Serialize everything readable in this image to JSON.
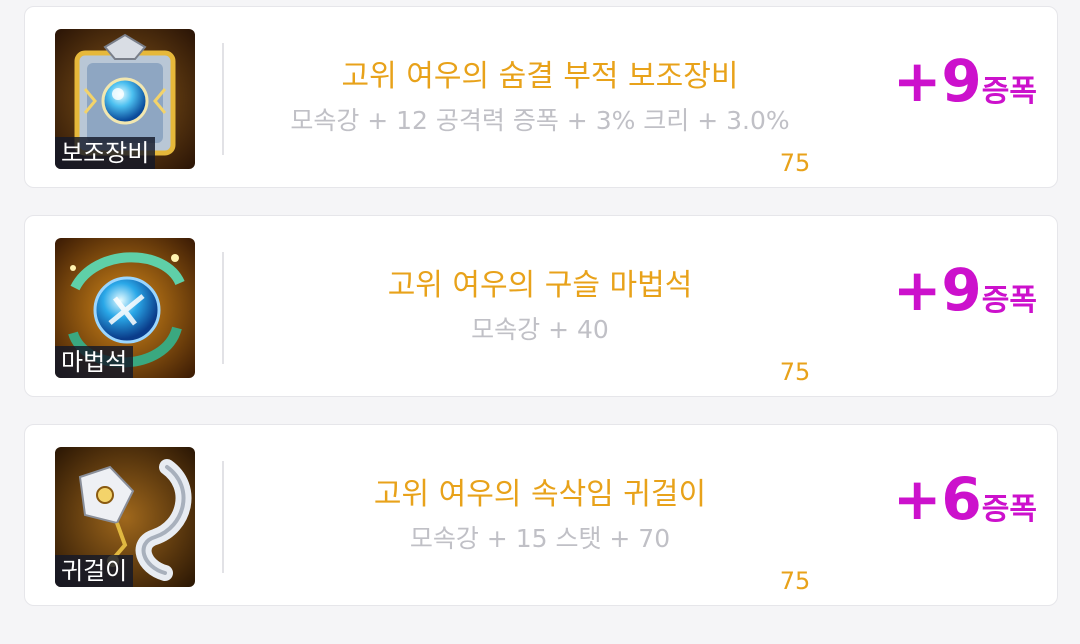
{
  "items": [
    {
      "icon": "secondary-weapon-talisman-icon",
      "category": "보조장비",
      "name": "고위 여우의 숨결 부적 보조장비",
      "stats": "모속강 + 12 공격력 증폭 + 3% 크리 + 3.0%",
      "level": "75",
      "bonus_value": "+9",
      "bonus_unit": "증폭"
    },
    {
      "icon": "magic-stone-orb-icon",
      "category": "마법석",
      "name": "고위 여우의 구슬 마법석",
      "stats": "모속강 + 40",
      "level": "75",
      "bonus_value": "+9",
      "bonus_unit": "증폭"
    },
    {
      "icon": "earring-fox-tail-icon",
      "category": "귀걸이",
      "name": "고위 여우의 속삭임 귀걸이",
      "stats": "모속강 + 15 스탯 + 70",
      "level": "75",
      "bonus_value": "+6",
      "bonus_unit": "증폭"
    }
  ],
  "colors": {
    "item_name": "#e8a21a",
    "stats": "#c0c0c6",
    "bonus": "#cc11cc"
  }
}
